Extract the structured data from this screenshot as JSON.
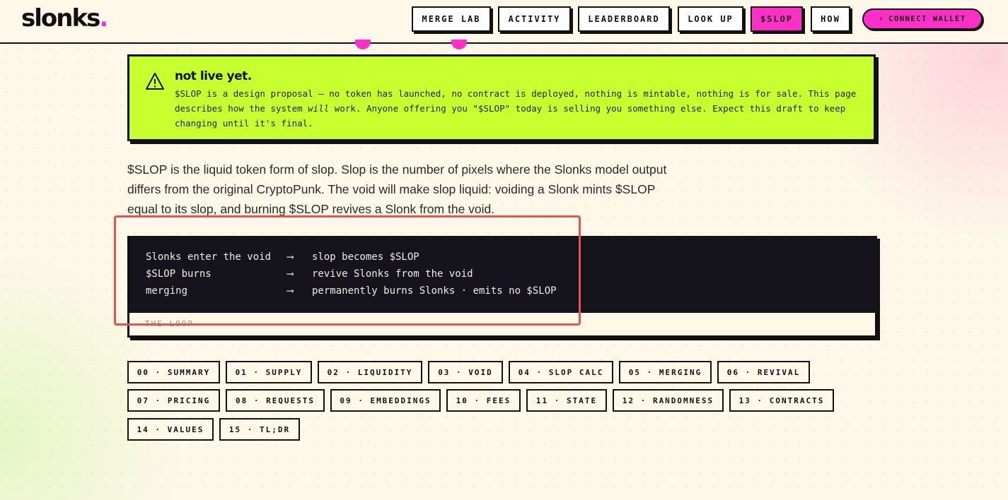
{
  "header": {
    "logo": "slonks",
    "logo_dot": ".",
    "nav": [
      {
        "label": "MERGE LAB",
        "active": false
      },
      {
        "label": "ACTIVITY",
        "active": false
      },
      {
        "label": "LEADERBOARD",
        "active": false
      },
      {
        "label": "LOOK UP",
        "active": false
      },
      {
        "label": "$SLOP",
        "active": true
      },
      {
        "label": "HOW",
        "active": false
      }
    ],
    "connect_wallet": "CONNECT WALLET",
    "connect_icon": "lightning-bolt-icon"
  },
  "warning": {
    "icon": "warning-triangle-icon",
    "title": "not live yet.",
    "body_part1": "$SLOP is a design proposal — no token has launched, no contract is deployed, nothing is mintable, nothing is for sale. This page describes how the system ",
    "body_em": "will",
    "body_part2": " work. Anyone offering you \"$SLOP\" today is selling you something else. Expect this draft to keep changing until it's final."
  },
  "intro": "$SLOP is the liquid token form of slop. Slop is the number of pixels where the Slonks model output differs from the original CryptoPunk. The void will make slop liquid: voiding a Slonk mints $SLOP equal to its slop, and burning $SLOP revives a Slonk from the void.",
  "loop": {
    "rows": [
      {
        "lhs": "Slonks enter the void",
        "arrow": "⟶",
        "rhs": "slop becomes $SLOP"
      },
      {
        "lhs": "$SLOP burns",
        "arrow": "⟶",
        "rhs": "revive Slonks from the void"
      },
      {
        "lhs": "merging",
        "arrow": "⟶",
        "rhs": "permanently burns Slonks · emits no $SLOP"
      }
    ],
    "caption": "THE LOOP"
  },
  "sections": [
    "00 · SUMMARY",
    "01 · SUPPLY",
    "02 · LIQUIDITY",
    "03 · VOID",
    "04 · SLOP CALC",
    "05 · MERGING",
    "06 · REVIVAL",
    "07 · PRICING",
    "08 · REQUESTS",
    "09 · EMBEDDINGS",
    "10 · FEES",
    "11 · STATE",
    "12 · RANDOMNESS",
    "13 · CONTRACTS",
    "14 · VALUES",
    "15 · TL;DR"
  ],
  "colors": {
    "accent_pink": "#ff2fc8",
    "warning_lime": "#c8ff2e",
    "code_bg": "#15131b",
    "highlight_red": "#e8524f"
  }
}
